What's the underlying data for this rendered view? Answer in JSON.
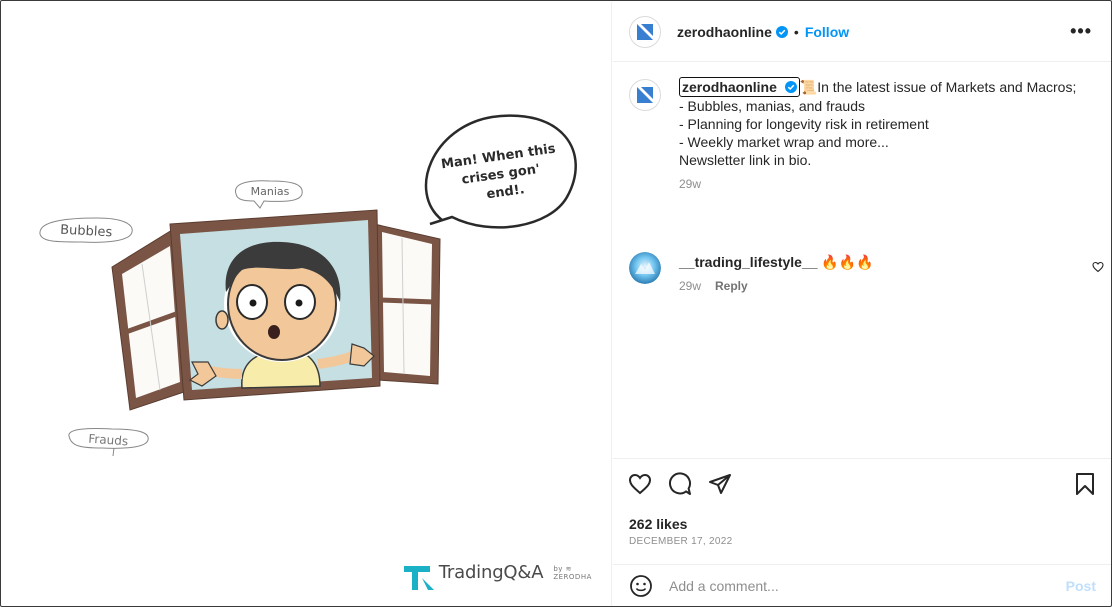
{
  "post": {
    "account": "zerodhaonline",
    "follow_label": "Follow",
    "separator": "•",
    "more_label": "•••",
    "caption_user": "zerodhaonline",
    "caption_emoji": "📜",
    "caption_lines": [
      "In the latest issue of Markets and Macros;",
      "",
      "- Bubbles, manias, and frauds",
      "- Planning for longevity risk in retirement",
      "- Weekly market wrap and more...",
      "",
      "Newsletter link in bio."
    ],
    "caption_age": "29w",
    "likes": "262 likes",
    "date": "DECEMBER 17, 2022",
    "comment_placeholder": "Add a comment...",
    "post_label": "Post"
  },
  "comments": [
    {
      "user": "__trading_lifestyle__",
      "text": "🔥🔥🔥",
      "age": "29w",
      "reply_label": "Reply"
    }
  ],
  "image": {
    "speech_bubble": [
      "Man! When this",
      "crises gon'",
      "end!."
    ],
    "tags": [
      "Manias",
      "Bubbles",
      "Frauds"
    ],
    "brand": "TradingQ&A",
    "brand_by": "by ≋ ZERODHA"
  },
  "colors": {
    "accent": "#0095f6",
    "verified": "#0095f6",
    "window_frame": "#7a5546",
    "sky": "#c5dfe3",
    "skin": "#f2c89a",
    "shirt": "#f7ecaa",
    "brand_teal": "#1ab0c5"
  }
}
